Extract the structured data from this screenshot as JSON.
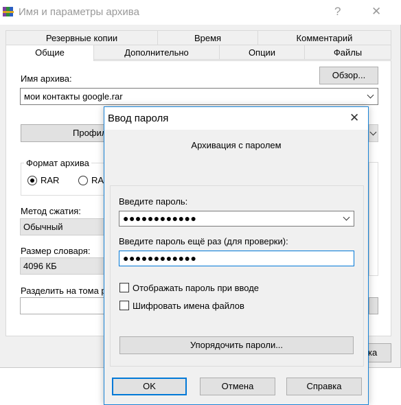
{
  "archive_dialog": {
    "title": "Имя и параметры архива",
    "help_glyph": "?",
    "close_glyph": "✕",
    "tabs_row_top": [
      "Резервные копии",
      "Время",
      "Комментарий"
    ],
    "tabs_row_bottom": [
      "Общие",
      "Дополнительно",
      "Опции",
      "Файлы"
    ],
    "active_tab": "Общие",
    "archive_name_label": "Имя архива:",
    "browse_button": "Обзор...",
    "archive_name_value": "мои контакты google.rar",
    "profiles_button": "Профил",
    "format_group_label": "Формат архива",
    "format_options": [
      "RAR",
      "RA"
    ],
    "selected_format": "RAR",
    "compression_label": "Метод сжатия:",
    "compression_value": "Обычный",
    "dictionary_label": "Размер словаря:",
    "dictionary_value": "4096 КБ",
    "split_label": "Разделить на тома р",
    "bottom_button_fragment": "ка"
  },
  "password_dialog": {
    "title": "Ввод пароля",
    "close_glyph": "✕",
    "subtitle": "Архивация с паролем",
    "enter_password_label": "Введите пароль:",
    "password_value": "●●●●●●●●●●●●",
    "reenter_label": "Введите пароль ещё раз (для проверки):",
    "reenter_value": "●●●●●●●●●●●●",
    "show_password_label": "Отображать пароль при вводе",
    "encrypt_names_label": "Шифровать имена файлов",
    "show_password_checked": false,
    "encrypt_names_checked": false,
    "organize_button": "Упорядочить пароли...",
    "ok_button": "OK",
    "cancel_button": "Отмена",
    "help_button": "Справка"
  },
  "colors": {
    "accent": "#0078d7",
    "dialog_border": "#1883d7",
    "window_bg": "#f0f0f0",
    "disabled_text": "#999999"
  },
  "icons": {
    "app_icon": "winrar-books-icon",
    "close": "close-icon",
    "help": "help-icon",
    "dropdown": "chevron-down-icon"
  }
}
